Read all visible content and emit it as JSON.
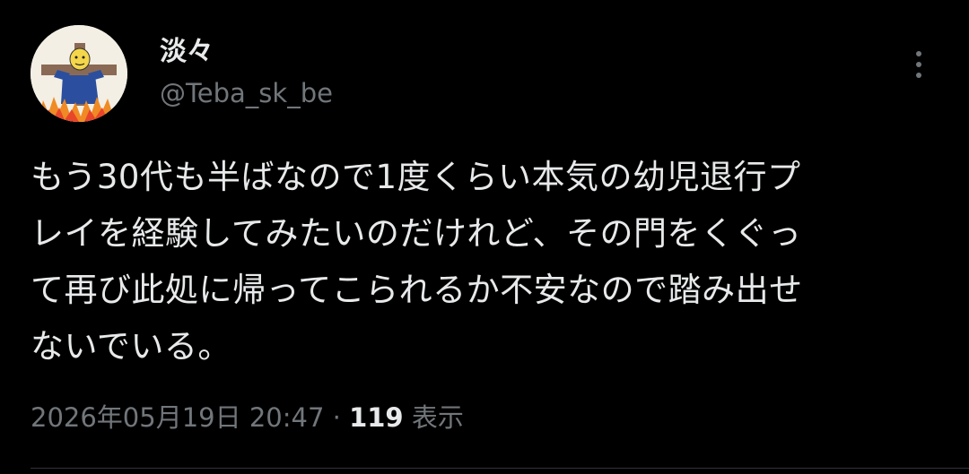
{
  "tweet": {
    "author": {
      "display_name": "淡々",
      "handle": "@Teba_sk_be"
    },
    "body_lines": [
      "もう30代も半ばなので1度くらい本気の幼児退行プ",
      "レイを経験してみたいのだけれど、その門をくぐっ",
      "て再び此処に帰ってこられるか不安なので踏み出せ",
      "ないでいる。"
    ],
    "timestamp": "2026年05月19日 20:47",
    "separator": "·",
    "views_count": "119",
    "views_label": "表示"
  },
  "icons": {
    "more": "more-vertical-icon",
    "avatar": "avatar-illustration"
  },
  "colors": {
    "background": "#000000",
    "primary_text": "#e7e9ea",
    "secondary_text": "#71767b",
    "divider": "#2f3336"
  }
}
